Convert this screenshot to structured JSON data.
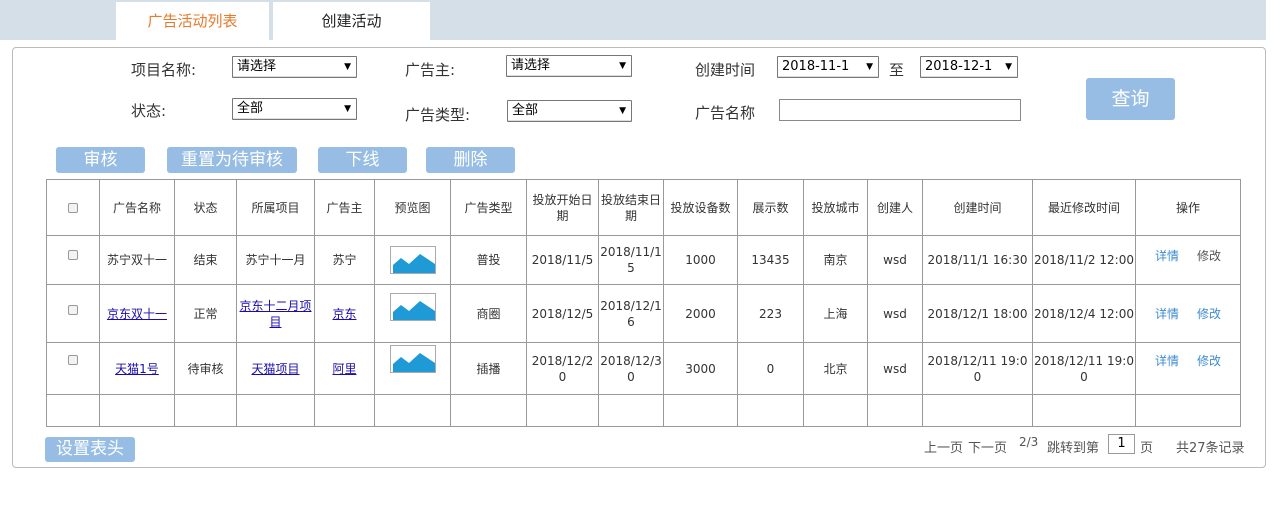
{
  "tabs": [
    {
      "label": "广告活动列表",
      "active": true
    },
    {
      "label": "创建活动",
      "active": false
    }
  ],
  "filters": {
    "project_label": "项目名称:",
    "project_value": "请选择",
    "advertiser_label": "广告主:",
    "advertiser_value": "请选择",
    "created_label": "创建时间",
    "created_from": "2018-11-1",
    "created_to_label": "至",
    "created_to": "2018-12-1",
    "status_label": "状态:",
    "status_value": "全部",
    "adtype_label": "广告类型:",
    "adtype_value": "全部",
    "adname_label": "广告名称",
    "adname_value": ""
  },
  "actions": {
    "query": "查询",
    "approve": "审核",
    "reset_pending": "重置为待审核",
    "offline": "下线",
    "delete": "删除",
    "set_header": "设置表头"
  },
  "table": {
    "headers": [
      "",
      "广告名称",
      "状态",
      "所属项目",
      "广告主",
      "预览图",
      "广告类型",
      "投放开始日期",
      "投放结束日期",
      "投放设备数",
      "展示数",
      "投放城市",
      "创建人",
      "创建时间",
      "最近修改时间",
      "操作"
    ],
    "rows": [
      {
        "name": "苏宁双十一",
        "status": "结束",
        "project": "苏宁十一月",
        "advertiser": "苏宁",
        "adtype": "普投",
        "start": "2018/11/5",
        "end": "2018/11/15",
        "devices": "1000",
        "impressions": "13435",
        "city": "南京",
        "creator": "wsd",
        "created": "2018/11/1 16:30",
        "modified": "2018/11/2 12:00",
        "op_detail": "详情",
        "op_edit": "修改"
      },
      {
        "name": "京东双十一",
        "status": "正常",
        "project": "京东十二月项目",
        "advertiser": "京东",
        "adtype": "商圈",
        "start": "2018/12/5",
        "end": "2018/12/16",
        "devices": "2000",
        "impressions": "223",
        "city": "上海",
        "creator": "wsd",
        "created": "2018/12/1 18:00",
        "modified": "2018/12/4 12:00",
        "op_detail": "详情",
        "op_edit": "修改"
      },
      {
        "name": "天猫1号",
        "status": "待审核",
        "project": "天猫项目",
        "advertiser": "阿里",
        "adtype": "插播",
        "start": "2018/12/20",
        "end": "2018/12/30",
        "devices": "3000",
        "impressions": "0",
        "city": "北京",
        "creator": "wsd",
        "created": "2018/12/11 19:00",
        "modified": "2018/12/11 19:00",
        "op_detail": "详情",
        "op_edit": "修改"
      }
    ]
  },
  "pager": {
    "prev": "上一页",
    "next": "下一页",
    "page_info": "2/3",
    "jump_label": "跳转到第",
    "jump_value": "1",
    "page_unit": "页",
    "total": "共27条记录"
  },
  "colors": {
    "accent_tab": "#e87a2a",
    "button": "#97bde4",
    "link": "#3d8bd0",
    "tabbar": "#d5dfe8"
  },
  "icons": [
    "checkbox-icon",
    "image-placeholder-icon",
    "dropdown-arrow-icon"
  ]
}
